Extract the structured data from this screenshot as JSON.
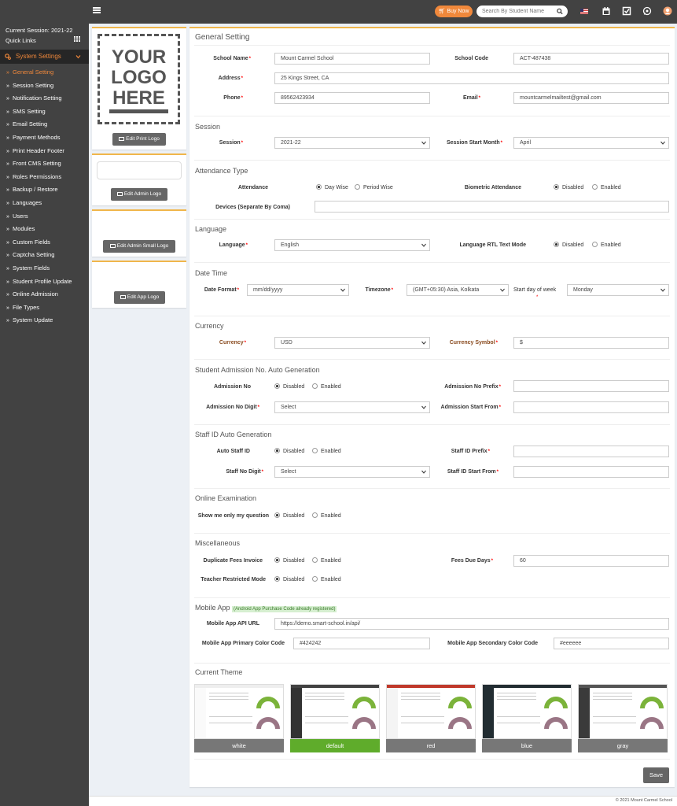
{
  "topbar": {
    "buy_now": "Buy Now",
    "search_placeholder": "Search By Student Name"
  },
  "sidebar": {
    "session": "Current Session: 2021-22",
    "quick_links": "Quick Links",
    "system_settings": "System Settings",
    "items": [
      {
        "label": "General Setting",
        "active": true
      },
      {
        "label": "Session Setting"
      },
      {
        "label": "Notification Setting"
      },
      {
        "label": "SMS Setting"
      },
      {
        "label": "Email Setting"
      },
      {
        "label": "Payment Methods"
      },
      {
        "label": "Print Header Footer"
      },
      {
        "label": "Front CMS Setting"
      },
      {
        "label": "Roles Permissions"
      },
      {
        "label": "Backup / Restore"
      },
      {
        "label": "Languages"
      },
      {
        "label": "Users"
      },
      {
        "label": "Modules"
      },
      {
        "label": "Custom Fields"
      },
      {
        "label": "Captcha Setting"
      },
      {
        "label": "System Fields"
      },
      {
        "label": "Student Profile Update"
      },
      {
        "label": "Online Admission"
      },
      {
        "label": "File Types"
      },
      {
        "label": "System Update"
      }
    ]
  },
  "logos": {
    "logo_text": [
      "YOUR",
      "LOGO",
      "HERE"
    ],
    "edit_print": "Edit Print Logo",
    "edit_admin": "Edit Admin Logo",
    "edit_admin_small": "Edit Admin Small Logo",
    "edit_app": "Edit App Logo"
  },
  "main": {
    "title": "General Setting",
    "school_name_label": "School Name",
    "school_name": "Mount Carmel School",
    "school_code_label": "School Code",
    "school_code": "ACT-487438",
    "address_label": "Address",
    "address": "25 Kings Street, CA",
    "phone_label": "Phone",
    "phone": "89562423934",
    "email_label": "Email",
    "email": "mountcarmelmailtest@gmail.com",
    "session_title": "Session",
    "session_label": "Session",
    "session_value": "2021-22",
    "session_start_label": "Session Start Month",
    "session_start_value": "April",
    "attendance_title": "Attendance Type",
    "attendance_label": "Attendance",
    "day_wise": "Day Wise",
    "period_wise": "Period Wise",
    "biometric_label": "Biometric Attendance",
    "devices_label": "Devices (Separate By Coma)",
    "language_title": "Language",
    "language_label": "Language",
    "language_value": "English",
    "rtl_label": "Language RTL Text Mode",
    "datetime_title": "Date Time",
    "date_format_label": "Date Format",
    "date_format_value": "mm/dd/yyyy",
    "timezone_label": "Timezone",
    "timezone_value": "(GMT+05:30) Asia, Kolkata",
    "start_day_label": "Start day of week",
    "start_day_value": "Monday",
    "currency_title": "Currency",
    "currency_label": "Currency",
    "currency_value": "USD",
    "currency_symbol_label": "Currency Symbol",
    "currency_symbol_value": "$",
    "admission_title": "Student Admission No. Auto Generation",
    "admission_no_label": "Admission No",
    "admission_prefix_label": "Admission No Prefix",
    "admission_digit_label": "Admission No Digit",
    "admission_start_label": "Admission Start From",
    "select_text": "Select",
    "staff_title": "Staff ID Auto Generation",
    "auto_staff_label": "Auto Staff ID",
    "staff_prefix_label": "Staff ID Prefix",
    "staff_digit_label": "Staff No Digit",
    "staff_start_label": "Staff ID Start From",
    "online_exam_title": "Online Examination",
    "show_question_label": "Show me only my question",
    "misc_title": "Miscellaneous",
    "dup_fees_label": "Duplicate Fees Invoice",
    "fees_due_label": "Fees Due Days",
    "fees_due_value": "60",
    "teacher_restricted_label": "Teacher Restricted Mode",
    "mobile_title": "Mobile App",
    "mobile_badge": "(Android App Purchase Code already registered)",
    "api_url_label": "Mobile App API URL",
    "api_url_value": "https://demo.smart-school.in/api/",
    "primary_color_label": "Mobile App Primary Color Code",
    "primary_color_value": "#424242",
    "secondary_color_label": "Mobile App Secondary Color Code",
    "secondary_color_value": "#eeeeee",
    "disabled": "Disabled",
    "enabled": "Enabled",
    "theme_title": "Current Theme",
    "themes": [
      {
        "name": "white",
        "color": "#777777"
      },
      {
        "name": "default",
        "color": "#5fac2b",
        "selected": true
      },
      {
        "name": "red",
        "color": "#777777"
      },
      {
        "name": "blue",
        "color": "#777777"
      },
      {
        "name": "gray",
        "color": "#777777"
      }
    ],
    "save": "Save"
  },
  "footer": "© 2021 Mount Carmel School",
  "colors": {
    "topbar": "#424242",
    "accent": "#f0883b",
    "card_border": "#f0b64b"
  }
}
